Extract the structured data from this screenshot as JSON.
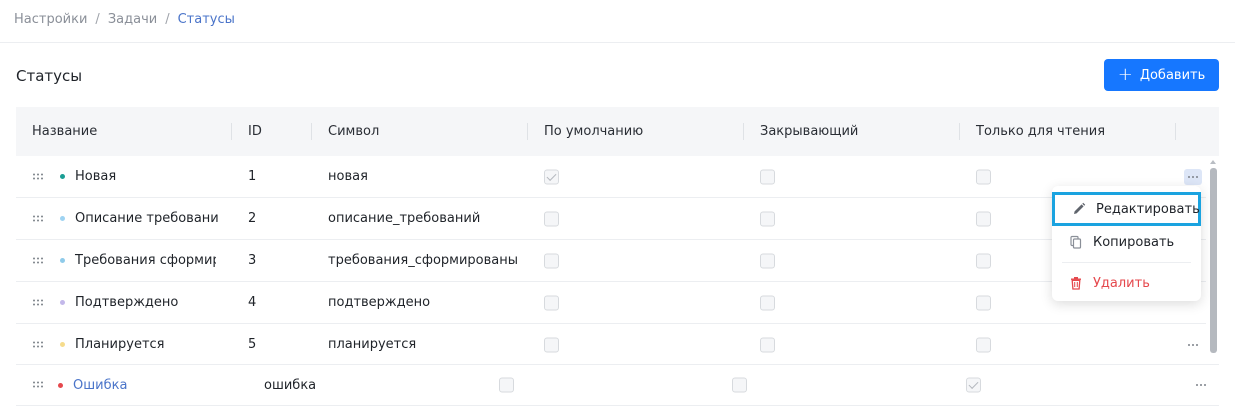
{
  "breadcrumb": {
    "items": [
      "Настройки",
      "Задачи",
      "Статусы"
    ],
    "separator": "/"
  },
  "page": {
    "title": "Статусы",
    "add_label": "Добавить"
  },
  "table": {
    "columns": [
      "Название",
      "ID",
      "Символ",
      "По умолчанию",
      "Закрывающий",
      "Только для чтения"
    ],
    "rows": [
      {
        "name": "Новая",
        "id": "1",
        "symbol": "новая",
        "dot": "#1a9e94",
        "default": true,
        "closing": false,
        "readonly": false
      },
      {
        "name": "Описание требований",
        "id": "2",
        "symbol": "описание_требований",
        "dot": "#9ed3f2",
        "default": false,
        "closing": false,
        "readonly": false
      },
      {
        "name": "Требования сформированы",
        "id": "3",
        "symbol": "требования_сформированы",
        "dot": "#8fcbea",
        "default": false,
        "closing": false,
        "readonly": false
      },
      {
        "name": "Подтверждено",
        "id": "4",
        "symbol": "подтверждено",
        "dot": "#c3b8ea",
        "default": false,
        "closing": false,
        "readonly": false
      },
      {
        "name": "Планируется",
        "id": "5",
        "symbol": "планируется",
        "dot": "#f6dc8c",
        "default": false,
        "closing": false,
        "readonly": false
      }
    ],
    "last_row": {
      "name": "Ошибка",
      "symbol": "ошибка",
      "dot": "#e5484d",
      "default": false,
      "closing": false,
      "readonly": true
    }
  },
  "context_menu": {
    "edit": "Редактировать",
    "copy": "Копировать",
    "delete": "Удалить"
  },
  "colors": {
    "accent": "#1677ff",
    "link": "#4a74c9",
    "danger": "#e5484d",
    "highlight": "#1aa3e0"
  },
  "icons": {
    "drag": "drag-handle-icon",
    "more": "more-horizontal-icon",
    "edit": "pencil-icon",
    "copy": "copy-icon",
    "delete": "trash-icon",
    "add": "plus-icon"
  }
}
